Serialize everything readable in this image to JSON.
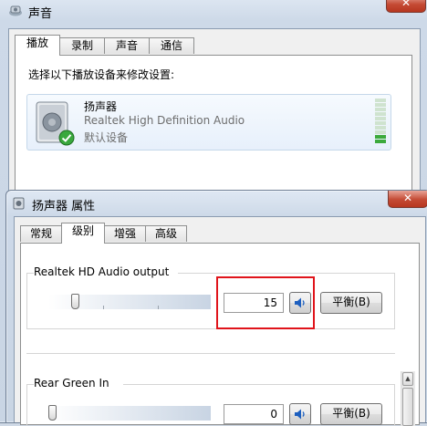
{
  "back_window": {
    "title": "声音",
    "close_glyph": "✕",
    "tabs": [
      {
        "label": "播放"
      },
      {
        "label": "录制"
      },
      {
        "label": "声音"
      },
      {
        "label": "通信"
      }
    ],
    "instruction": "选择以下播放设备来修改设置:",
    "device": {
      "name": "扬声器",
      "driver": "Realtek High Definition Audio",
      "status": "默认设备",
      "icon": "speaker-icon",
      "status_icon": "green-check-icon",
      "level_meter_fraction": 0.2
    }
  },
  "front_window": {
    "title": "扬声器 属性",
    "close_glyph": "✕",
    "tabs": [
      {
        "label": "常规"
      },
      {
        "label": "级别"
      },
      {
        "label": "增强"
      },
      {
        "label": "高级"
      }
    ],
    "levels": [
      {
        "label": "Realtek HD Audio output",
        "value": "15",
        "slider_fraction": 0.15,
        "balance_label": "平衡(B)"
      },
      {
        "label": "Rear Green In",
        "value": "0",
        "slider_fraction": 0.0,
        "balance_label": "平衡(B)"
      }
    ]
  },
  "colors": {
    "highlight_box": "#e0141b",
    "level_on": "#3caa3c",
    "level_off": "#cfe3cf"
  }
}
